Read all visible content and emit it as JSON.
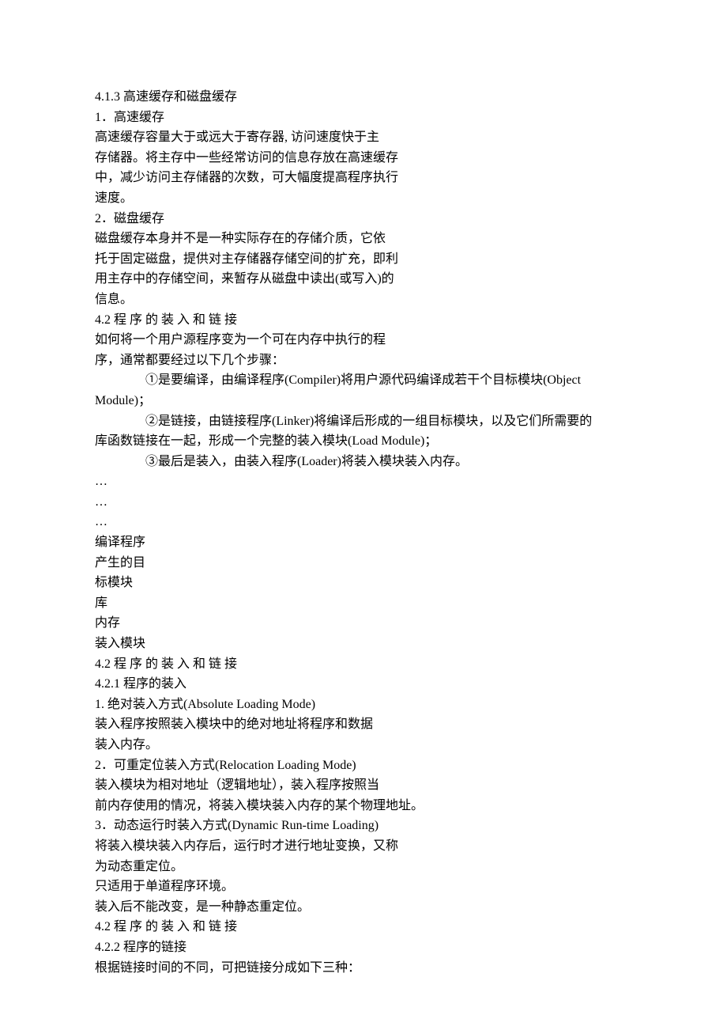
{
  "lines": [
    "4.1.3   高速缓存和磁盘缓存",
    "1．高速缓存",
    "高速缓存容量大于或远大于寄存器, 访问速度快于主",
    "存储器。将主存中一些经常访问的信息存放在高速缓存",
    "中，减少访问主存储器的次数，可大幅度提高程序执行",
    "速度。",
    "2．磁盘缓存",
    "磁盘缓存本身并不是一种实际存在的存储介质，它依",
    "托于固定磁盘，提供对主存储器存储空间的扩充，即利",
    "用主存中的存储空间，来暂存从磁盘中读出(或写入)的",
    "信息。",
    "4.2    程 序 的 装 入 和 链 接",
    "如何将一个用户源程序变为一个可在内存中执行的程",
    "序，通常都要经过以下几个步骤："
  ],
  "indentedLines": [
    "①是要编译，由编译程序(Compiler)将用户源代码编译成若干个目标模块(Object"
  ],
  "lines2": [
    "Module)；"
  ],
  "indentedLines2": [
    "②是链接，由链接程序(Linker)将编译后形成的一组目标模块，以及它们所需要的"
  ],
  "lines3": [
    "库函数链接在一起，形成一个完整的装入模块(Load Module)；"
  ],
  "indentedLines3": [
    "③最后是装入，由装入程序(Loader)将装入模块装入内存。"
  ],
  "lines4": [
    "…",
    "…",
    "…",
    "编译程序",
    "产生的目",
    "标模块",
    "库",
    "内存",
    "装入模块",
    "4.2    程 序 的 装 入 和 链 接",
    "4.2.1   程序的装入",
    "1. 绝对装入方式(Absolute Loading Mode)",
    "装入程序按照装入模块中的绝对地址将程序和数据",
    "装入内存。",
    "2．可重定位装入方式(Relocation Loading Mode)",
    "装入模块为相对地址（逻辑地址），装入程序按照当",
    "前内存使用的情况，将装入模块装入内存的某个物理地址。",
    "3．动态运行时装入方式(Dynamic Run-time Loading)",
    "将装入模块装入内存后，运行时才进行地址变换，又称",
    "为动态重定位。",
    "只适用于单道程序环境。",
    "装入后不能改变，是一种静态重定位。",
    "4.2    程 序 的 装 入 和 链 接",
    "4.2.2   程序的链接",
    "根据链接时间的不同，可把链接分成如下三种："
  ]
}
